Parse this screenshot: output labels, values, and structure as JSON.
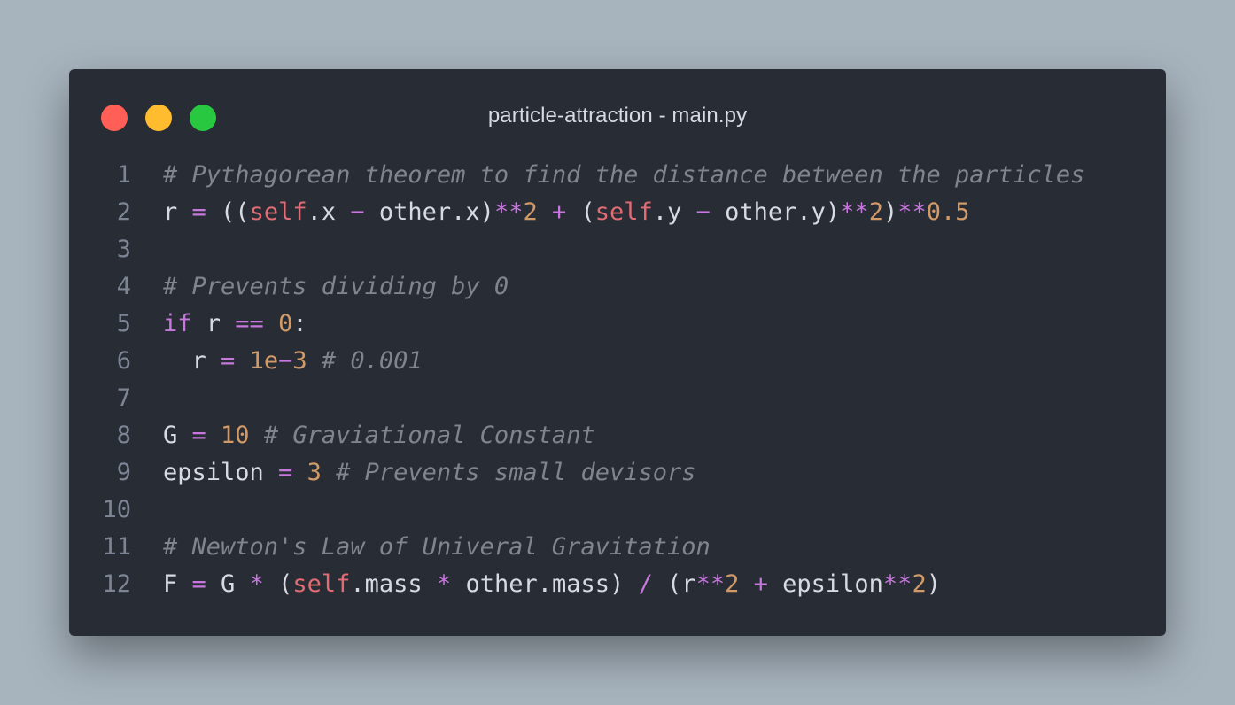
{
  "window": {
    "title": "particle-attraction - main.py",
    "controls": {
      "close_color": "#ff5f57",
      "minimize_color": "#febc2e",
      "maximize_color": "#28c840"
    }
  },
  "theme": {
    "background": "#282c34",
    "text": "#d7dae0",
    "comment": "#7f848e",
    "keyword": "#c678dd",
    "self": "#e06c75",
    "number": "#d19a66",
    "line_number": "#7d8594"
  },
  "code": {
    "language": "python",
    "lines": [
      {
        "number": "1",
        "tokens": [
          {
            "t": "comment",
            "v": "# Pythagorean theorem to find the distance between the particles"
          }
        ]
      },
      {
        "number": "2",
        "tokens": [
          {
            "t": "plain",
            "v": "r "
          },
          {
            "t": "op",
            "v": "="
          },
          {
            "t": "plain",
            "v": " (("
          },
          {
            "t": "self",
            "v": "self"
          },
          {
            "t": "plain",
            "v": ".x "
          },
          {
            "t": "op",
            "v": "−"
          },
          {
            "t": "plain",
            "v": " other.x)"
          },
          {
            "t": "op",
            "v": "**"
          },
          {
            "t": "number",
            "v": "2"
          },
          {
            "t": "plain",
            "v": " "
          },
          {
            "t": "op",
            "v": "+"
          },
          {
            "t": "plain",
            "v": " ("
          },
          {
            "t": "self",
            "v": "self"
          },
          {
            "t": "plain",
            "v": ".y "
          },
          {
            "t": "op",
            "v": "−"
          },
          {
            "t": "plain",
            "v": " other.y)"
          },
          {
            "t": "op",
            "v": "**"
          },
          {
            "t": "number",
            "v": "2"
          },
          {
            "t": "plain",
            "v": ")"
          },
          {
            "t": "op",
            "v": "**"
          },
          {
            "t": "number",
            "v": "0.5"
          }
        ]
      },
      {
        "number": "3",
        "tokens": []
      },
      {
        "number": "4",
        "tokens": [
          {
            "t": "comment",
            "v": "# Prevents dividing by 0"
          }
        ]
      },
      {
        "number": "5",
        "tokens": [
          {
            "t": "keyword",
            "v": "if"
          },
          {
            "t": "plain",
            "v": " r "
          },
          {
            "t": "op",
            "v": "=="
          },
          {
            "t": "plain",
            "v": " "
          },
          {
            "t": "number",
            "v": "0"
          },
          {
            "t": "plain",
            "v": ":"
          }
        ]
      },
      {
        "number": "6",
        "tokens": [
          {
            "t": "plain",
            "v": "  r "
          },
          {
            "t": "op",
            "v": "="
          },
          {
            "t": "plain",
            "v": " "
          },
          {
            "t": "number",
            "v": "1e"
          },
          {
            "t": "op",
            "v": "−"
          },
          {
            "t": "number",
            "v": "3"
          },
          {
            "t": "plain",
            "v": " "
          },
          {
            "t": "comment",
            "v": "# 0.001"
          }
        ]
      },
      {
        "number": "7",
        "tokens": []
      },
      {
        "number": "8",
        "tokens": [
          {
            "t": "plain",
            "v": "G "
          },
          {
            "t": "op",
            "v": "="
          },
          {
            "t": "plain",
            "v": " "
          },
          {
            "t": "number",
            "v": "10"
          },
          {
            "t": "plain",
            "v": " "
          },
          {
            "t": "comment",
            "v": "# Graviational Constant"
          }
        ]
      },
      {
        "number": "9",
        "tokens": [
          {
            "t": "plain",
            "v": "epsilon "
          },
          {
            "t": "op",
            "v": "="
          },
          {
            "t": "plain",
            "v": " "
          },
          {
            "t": "number",
            "v": "3"
          },
          {
            "t": "plain",
            "v": " "
          },
          {
            "t": "comment",
            "v": "# Prevents small devisors"
          }
        ]
      },
      {
        "number": "10",
        "tokens": []
      },
      {
        "number": "11",
        "tokens": [
          {
            "t": "comment",
            "v": "# Newton's Law of Univeral Gravitation"
          }
        ]
      },
      {
        "number": "12",
        "tokens": [
          {
            "t": "plain",
            "v": "F "
          },
          {
            "t": "op",
            "v": "="
          },
          {
            "t": "plain",
            "v": " G "
          },
          {
            "t": "op",
            "v": "*"
          },
          {
            "t": "plain",
            "v": " ("
          },
          {
            "t": "self",
            "v": "self"
          },
          {
            "t": "plain",
            "v": ".mass "
          },
          {
            "t": "op",
            "v": "*"
          },
          {
            "t": "plain",
            "v": " other.mass) "
          },
          {
            "t": "op",
            "v": "/"
          },
          {
            "t": "plain",
            "v": " (r"
          },
          {
            "t": "op",
            "v": "**"
          },
          {
            "t": "number",
            "v": "2"
          },
          {
            "t": "plain",
            "v": " "
          },
          {
            "t": "op",
            "v": "+"
          },
          {
            "t": "plain",
            "v": " epsilon"
          },
          {
            "t": "op",
            "v": "**"
          },
          {
            "t": "number",
            "v": "2"
          },
          {
            "t": "plain",
            "v": ")"
          }
        ]
      }
    ]
  }
}
